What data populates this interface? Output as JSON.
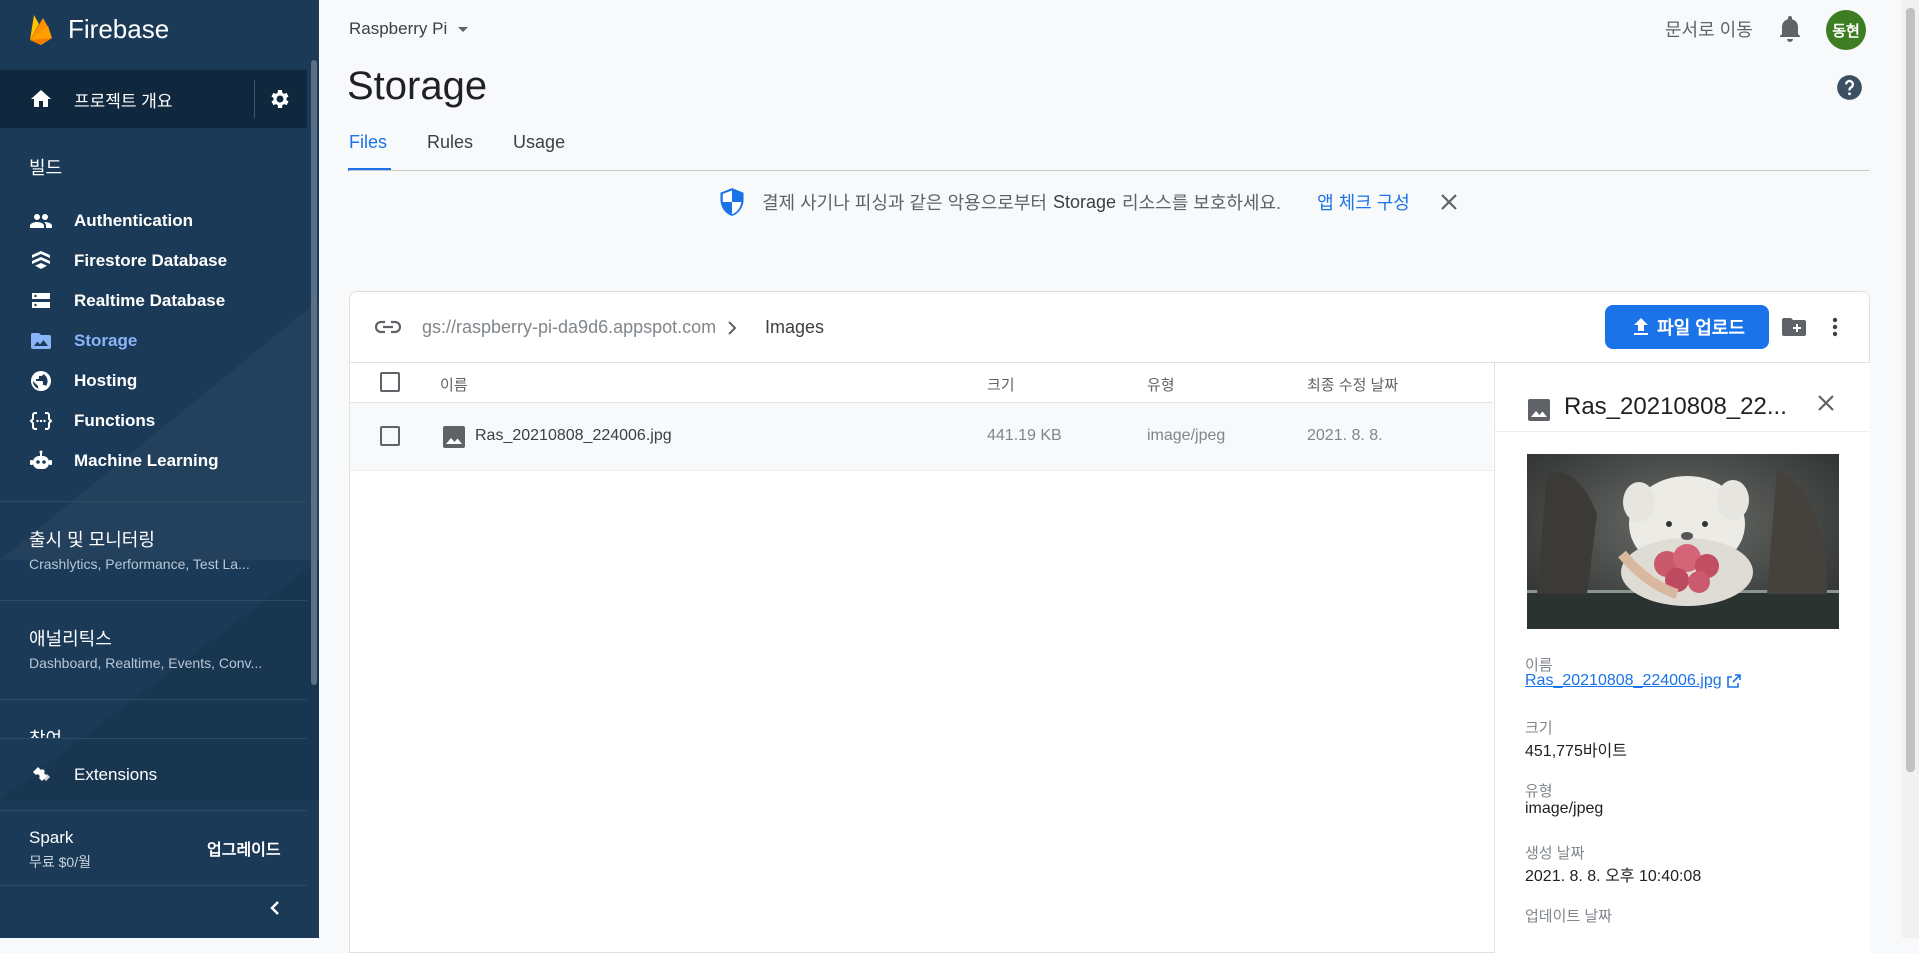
{
  "sidebar": {
    "brand": "Firebase",
    "overview": "프로젝트 개요",
    "build_title": "빌드",
    "items": [
      {
        "label": "Authentication",
        "icon": "people-icon"
      },
      {
        "label": "Firestore Database",
        "icon": "firestore-icon"
      },
      {
        "label": "Realtime Database",
        "icon": "database-icon"
      },
      {
        "label": "Storage",
        "icon": "folder-image-icon",
        "active": true
      },
      {
        "label": "Hosting",
        "icon": "globe-icon"
      },
      {
        "label": "Functions",
        "icon": "functions-icon"
      },
      {
        "label": "Machine Learning",
        "icon": "robot-icon"
      }
    ],
    "release_title": "출시 및 모니터링",
    "release_sub": "Crashlytics, Performance, Test La...",
    "analytics_title": "애널리틱스",
    "analytics_sub": "Dashboard, Realtime, Events, Conv...",
    "engage_title": "참여",
    "extensions": "Extensions",
    "plan_name": "Spark",
    "plan_price": "무료 $0/월",
    "upgrade": "업그레이드"
  },
  "header": {
    "project": "Raspberry Pi",
    "docs_link": "문서로 이동",
    "avatar": "동현",
    "title": "Storage",
    "tabs": [
      "Files",
      "Rules",
      "Usage"
    ]
  },
  "banner": {
    "text_before": "결제 사기나 피싱과 같은 악용으로부터",
    "text_bold": "Storage",
    "text_after": "리소스를 보호하세요.",
    "link": "앱 체크 구성"
  },
  "storage": {
    "bucket": "gs://raspberry-pi-da9d6.appspot.com",
    "folder": "Images",
    "upload_label": "파일 업로드",
    "columns": {
      "name": "이름",
      "size": "크기",
      "type": "유형",
      "modified": "최종 수정 날짜"
    },
    "rows": [
      {
        "name": "Ras_20210808_224006.jpg",
        "size": "441.19 KB",
        "type": "image/jpeg",
        "modified": "2021. 8. 8."
      }
    ]
  },
  "detail": {
    "title": "Ras_20210808_22...",
    "name_label": "이름",
    "name_value": "Ras_20210808_224006.jpg",
    "size_label": "크기",
    "size_value": "451,775바이트",
    "type_label": "유형",
    "type_value": "image/jpeg",
    "created_label": "생성 날짜",
    "created_value": "2021. 8. 8. 오후 10:40:08",
    "updated_label": "업데이트 날짜"
  },
  "colors": {
    "sidebar": "#1b3a57",
    "accent": "#1a73e8",
    "active_nav": "#8ab4f8",
    "avatar": "#3d7e22"
  }
}
